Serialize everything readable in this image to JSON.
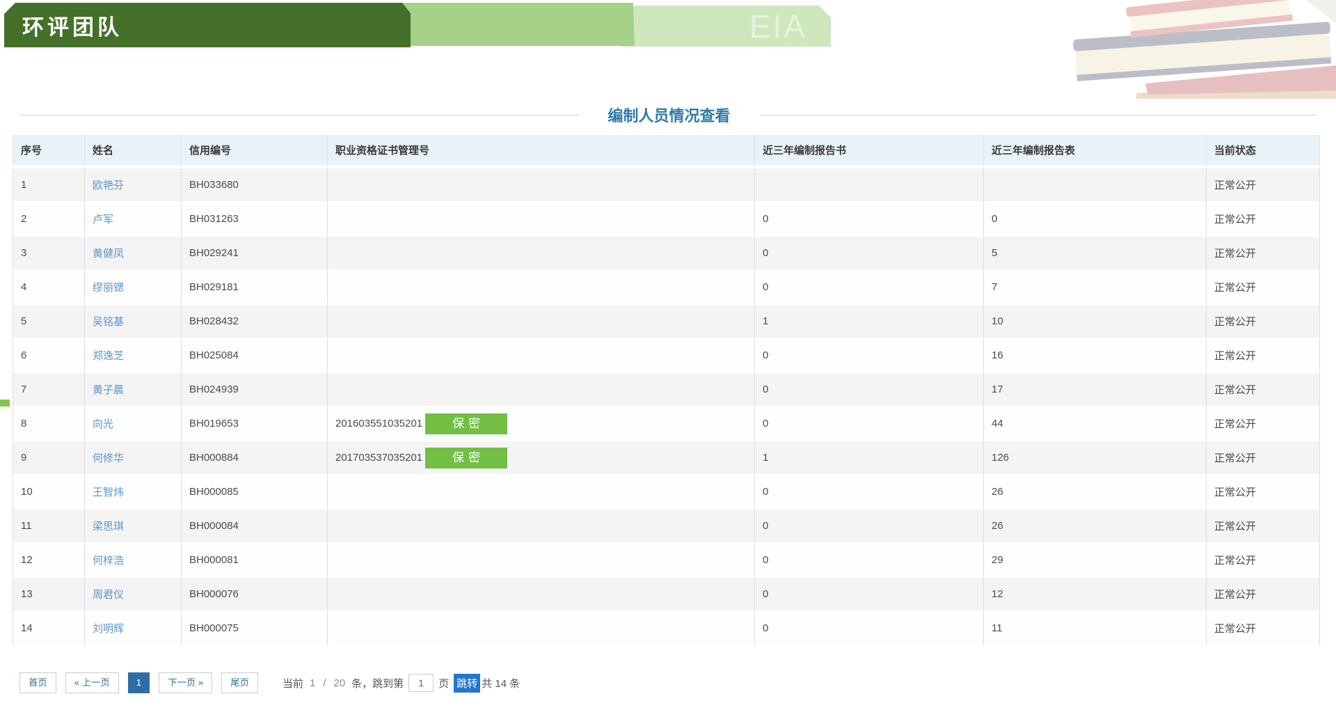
{
  "banner": {
    "team_label": "环评团队",
    "eia_label": "EIA"
  },
  "title": {
    "text": "编制人员情况查看"
  },
  "table": {
    "headers": [
      "序号",
      "姓名",
      "信用编号",
      "职业资格证书管理号",
      "近三年编制报告书",
      "近三年编制报告表",
      "当前状态"
    ],
    "rows": [
      {
        "no": "1",
        "name": "欧艳芬",
        "credit": "BH033680",
        "cert": "",
        "badge": "",
        "reports": "",
        "forms": "",
        "status": "正常公开"
      },
      {
        "no": "2",
        "name": "卢军",
        "credit": "BH031263",
        "cert": "",
        "badge": "",
        "reports": "0",
        "forms": "0",
        "status": "正常公开"
      },
      {
        "no": "3",
        "name": "黄健凤",
        "credit": "BH029241",
        "cert": "",
        "badge": "",
        "reports": "0",
        "forms": "5",
        "status": "正常公开"
      },
      {
        "no": "4",
        "name": "缪丽锶",
        "credit": "BH029181",
        "cert": "",
        "badge": "",
        "reports": "0",
        "forms": "7",
        "status": "正常公开"
      },
      {
        "no": "5",
        "name": "吴铭基",
        "credit": "BH028432",
        "cert": "",
        "badge": "",
        "reports": "1",
        "forms": "10",
        "status": "正常公开"
      },
      {
        "no": "6",
        "name": "郑逸芝",
        "credit": "BH025084",
        "cert": "",
        "badge": "",
        "reports": "0",
        "forms": "16",
        "status": "正常公开"
      },
      {
        "no": "7",
        "name": "黄子晨",
        "credit": "BH024939",
        "cert": "",
        "badge": "",
        "reports": "0",
        "forms": "17",
        "status": "正常公开"
      },
      {
        "no": "8",
        "name": "向光",
        "credit": "BH019653",
        "cert": "201603551035201",
        "badge": "保密",
        "reports": "0",
        "forms": "44",
        "status": "正常公开"
      },
      {
        "no": "9",
        "name": "何修华",
        "credit": "BH000884",
        "cert": "201703537035201",
        "badge": "保密",
        "reports": "1",
        "forms": "126",
        "status": "正常公开"
      },
      {
        "no": "10",
        "name": "王智炜",
        "credit": "BH000085",
        "cert": "",
        "badge": "",
        "reports": "0",
        "forms": "26",
        "status": "正常公开"
      },
      {
        "no": "11",
        "name": "梁思琪",
        "credit": "BH000084",
        "cert": "",
        "badge": "",
        "reports": "0",
        "forms": "26",
        "status": "正常公开"
      },
      {
        "no": "12",
        "name": "何梓浩",
        "credit": "BH000081",
        "cert": "",
        "badge": "",
        "reports": "0",
        "forms": "29",
        "status": "正常公开"
      },
      {
        "no": "13",
        "name": "周君仪",
        "credit": "BH000076",
        "cert": "",
        "badge": "",
        "reports": "0",
        "forms": "12",
        "status": "正常公开"
      },
      {
        "no": "14",
        "name": "刘明辉",
        "credit": "BH000075",
        "cert": "",
        "badge": "",
        "reports": "0",
        "forms": "11",
        "status": "正常公开"
      }
    ]
  },
  "pagination": {
    "first_label": "首页",
    "prev_label": "« 上一页",
    "active_page": "1",
    "next_label": "下一页 »",
    "last_label": "尾页",
    "current_label": "当前",
    "current_page": "1",
    "separator": "/",
    "page_size": "20",
    "jump_prefix": "条，跳到第",
    "jump_value": "1",
    "jump_suffix": "页",
    "jump_button_label": "跳转",
    "total_label": "共 14 条"
  },
  "colors": {
    "banner_dark_green": "#45702a",
    "banner_mid_green": "#a6d189",
    "banner_light_green": "#cfe7bd",
    "title_blue": "#2e7ba6",
    "name_link_blue": "#5b94c8",
    "badge_green": "#72bf44",
    "header_bg": "#e9f2f7",
    "active_page_blue": "#2e6da4",
    "jump_button_blue": "#2476cc"
  }
}
